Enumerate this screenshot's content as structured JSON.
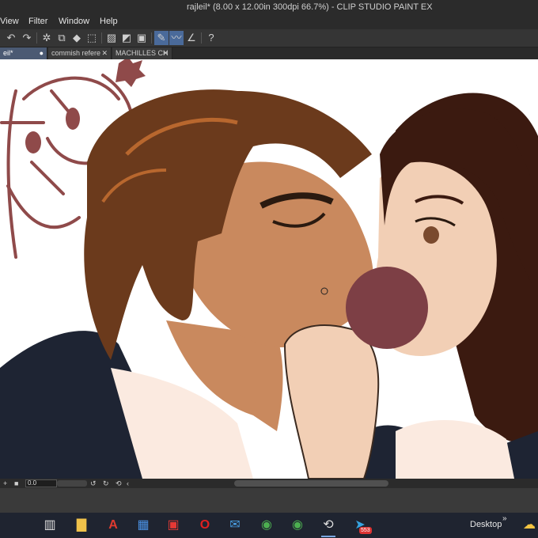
{
  "window": {
    "title": "rajleil* (8.00 x 12.00in 300dpi 66.7%) - CLIP STUDIO PAINT EX"
  },
  "menu": [
    "View",
    "Filter",
    "Window",
    "Help"
  ],
  "toolbar": {
    "icons": [
      "undo-icon",
      "redo-icon",
      "clear-selection-icon",
      "crop-icon",
      "fill-icon",
      "transform-icon",
      "deselect-icon",
      "invert-selection-icon",
      "expand-selection-icon",
      "pen-tool-icon",
      "brush-tool-icon",
      "ruler-tool-icon",
      "help-icon"
    ]
  },
  "tabs": [
    {
      "label": "eil*",
      "active": true
    },
    {
      "label": "commish refere",
      "active": false
    },
    {
      "label": "MACHILLES CH",
      "active": false
    }
  ],
  "status": {
    "zoom": "0.0"
  },
  "taskbar": {
    "apps": [
      "task-view",
      "file-explorer",
      "adobe-acrobat",
      "microsoft-store",
      "gift-app",
      "opera",
      "mail",
      "chrome",
      "chrome",
      "clip-studio-paint",
      "telegram"
    ],
    "telegram_badge": "553",
    "desktop_label": "Desktop",
    "chevron": "»"
  },
  "colors": {
    "hair": "#6b3a1c",
    "skin_man": "#c9895e",
    "skin_woman": "#f2cfb5",
    "suit": "#1e2433",
    "shirt": "#fbeae0",
    "sketch_red": "#8f4a4a",
    "color_swatch": "#7d3f45"
  }
}
